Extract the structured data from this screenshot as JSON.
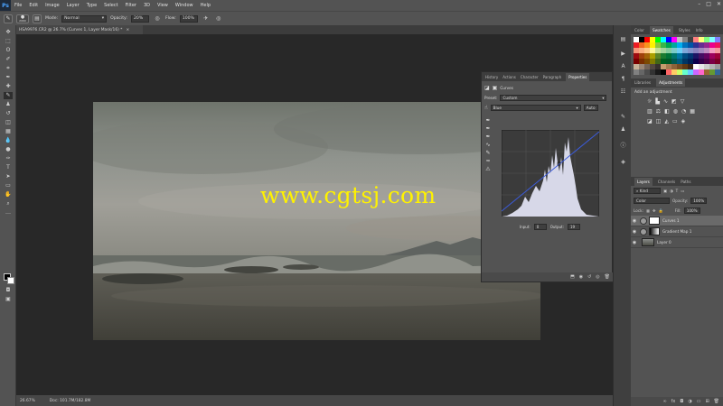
{
  "app": {
    "logo": "Ps"
  },
  "menu": [
    "File",
    "Edit",
    "Image",
    "Layer",
    "Type",
    "Select",
    "Filter",
    "3D",
    "View",
    "Window",
    "Help"
  ],
  "window_controls": [
    "–",
    "□",
    "✕"
  ],
  "options": {
    "brush_size": "2060",
    "mode_label": "Mode:",
    "mode_value": "Normal",
    "opacity_label": "Opacity:",
    "opacity_value": "20%",
    "flow_label": "Flow:",
    "flow_value": "100%"
  },
  "document": {
    "tab_title": "HSA9976.CR2 @ 26.7% (Curves 1, Layer Mask/16) *",
    "close": "×"
  },
  "status": {
    "zoom": "26.67%",
    "doc": "Doc: 101.7M/182.8M"
  },
  "watermark": "www.cgtsj.com",
  "properties": {
    "tabs": [
      "History",
      "Actions",
      "Character",
      "Paragraph",
      "Properties"
    ],
    "active_tab": "Properties",
    "title": "Curves",
    "preset_label": "Preset:",
    "preset_value": "Custom",
    "channel_value": "Blue",
    "auto_label": "Auto",
    "input_label": "Input:",
    "input_value": "0",
    "output_label": "Output:",
    "output_value": "19"
  },
  "swatches_panel": {
    "tabs": [
      "Color",
      "Swatches",
      "Styles",
      "Info"
    ],
    "active_tab": "Swatches"
  },
  "adjustments_panel": {
    "tabs": [
      "Libraries",
      "Adjustments"
    ],
    "active_tab": "Adjustments",
    "title": "Add an adjustment"
  },
  "layers_panel": {
    "tabs": [
      "Layers",
      "Channels",
      "Paths"
    ],
    "active_tab": "Layers",
    "kind_value": "Kind",
    "blend_value": "Color",
    "opacity_label": "Opacity:",
    "opacity_value": "100%",
    "lock_label": "Lock:",
    "fill_label": "Fill:",
    "fill_value": "100%",
    "layers": [
      {
        "name": "Curves 1",
        "selected": true
      },
      {
        "name": "Gradient Map 1",
        "selected": false
      },
      {
        "name": "Layer 0",
        "selected": false
      }
    ]
  },
  "colors": {
    "ps_blue": "#4aa3ff",
    "watermark": "#fff200"
  }
}
